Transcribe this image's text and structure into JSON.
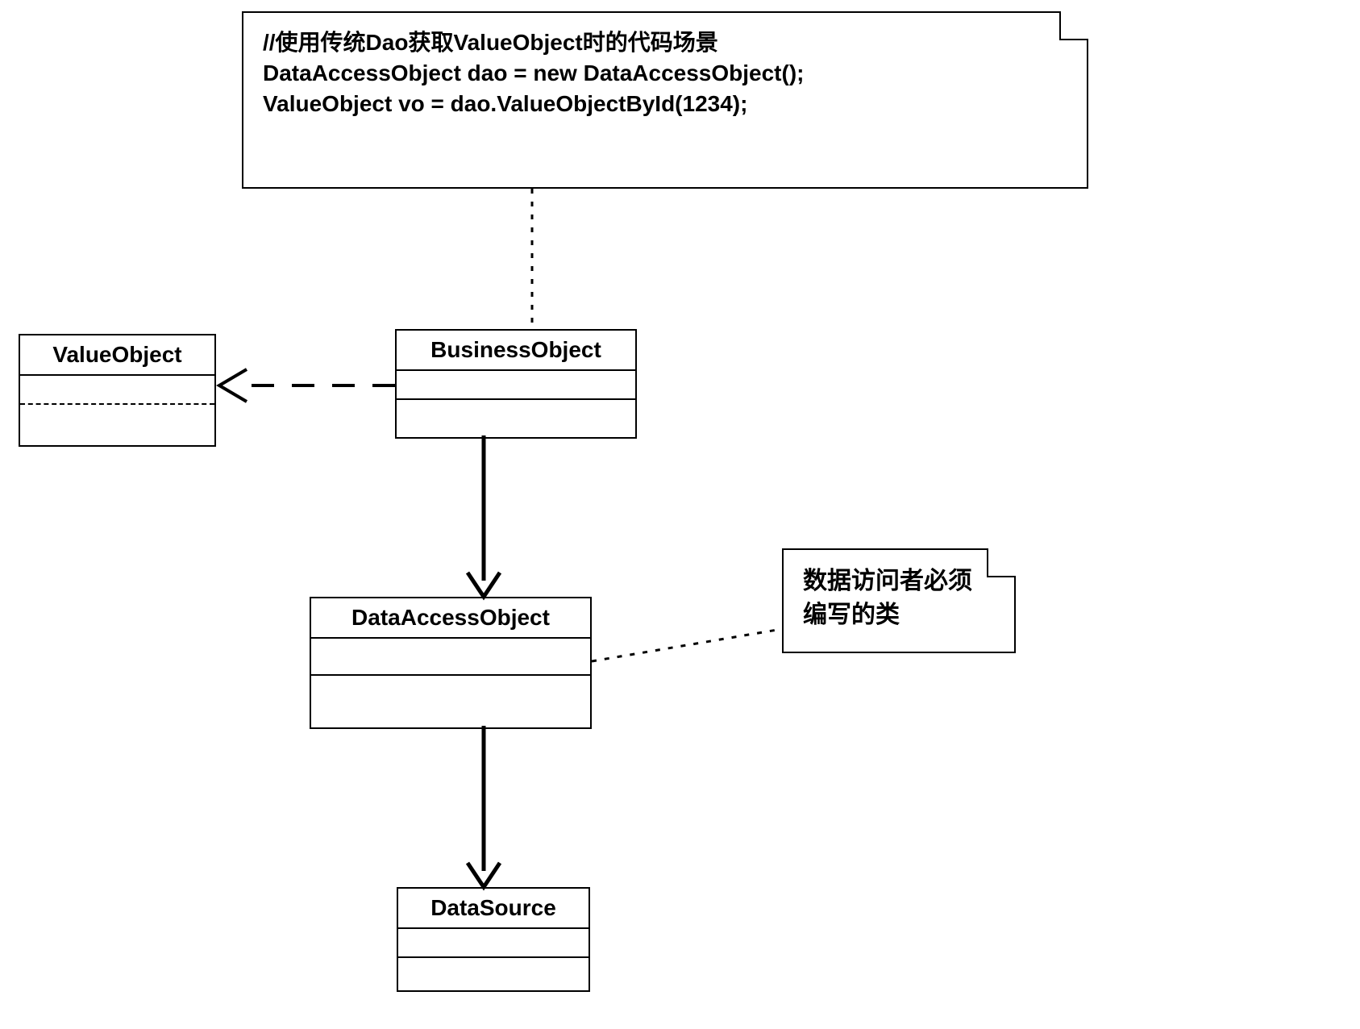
{
  "diagram": {
    "note_code": {
      "line1": "//使用传统Dao获取ValueObject时的代码场景",
      "line2": "DataAccessObject dao = new DataAccessObject();",
      "line3": "ValueObject vo = dao.ValueObjectById(1234);"
    },
    "note_right": {
      "line1": "数据访问者必须",
      "line2": "编写的类"
    },
    "classes": {
      "value_object": "ValueObject",
      "business_object": "BusinessObject",
      "data_access_object": "DataAccessObject",
      "data_source": "DataSource"
    }
  }
}
